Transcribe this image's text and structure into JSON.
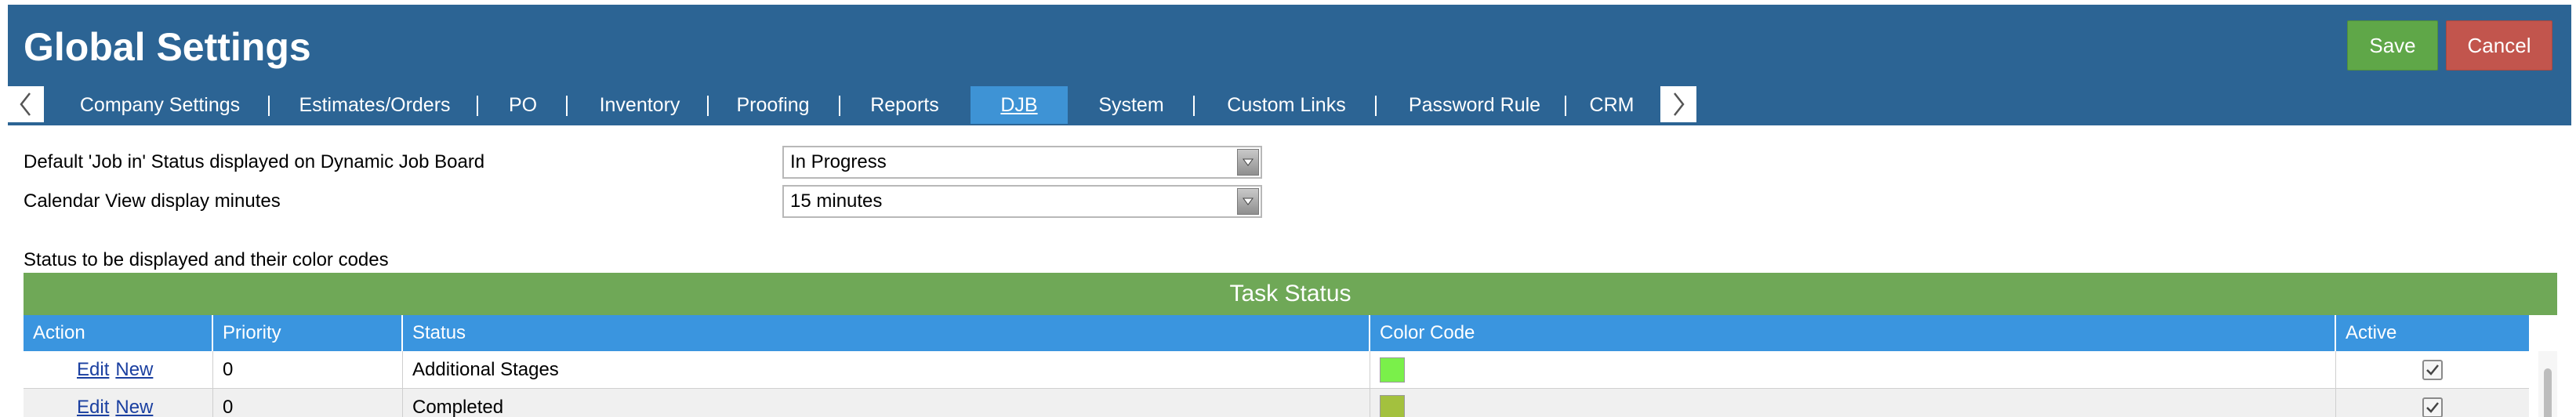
{
  "header": {
    "title": "Global Settings",
    "save_label": "Save",
    "cancel_label": "Cancel"
  },
  "tabs": [
    {
      "label": "Company Settings",
      "active": false
    },
    {
      "label": "Estimates/Orders",
      "active": false
    },
    {
      "label": "PO",
      "active": false
    },
    {
      "label": "Inventory",
      "active": false
    },
    {
      "label": "Proofing",
      "active": false
    },
    {
      "label": "Reports",
      "active": false
    },
    {
      "label": "DJB",
      "active": true
    },
    {
      "label": "System",
      "active": false
    },
    {
      "label": "Custom Links",
      "active": false
    },
    {
      "label": "Password Rule",
      "active": false
    },
    {
      "label": "CRM",
      "active": false
    }
  ],
  "settings": {
    "job_in_status": {
      "label": "Default 'Job in' Status displayed on Dynamic Job Board",
      "value": "In Progress"
    },
    "calendar_minutes": {
      "label": "Calendar View display minutes",
      "value": "15 minutes"
    }
  },
  "status_section_label": "Status to be displayed and their color codes",
  "task_status_table": {
    "title": "Task Status",
    "columns": [
      "Action",
      "Priority",
      "Status",
      "Color Code",
      "Active"
    ],
    "rows": [
      {
        "edit": "Edit",
        "new": "New",
        "priority": "0",
        "status": "Additional Stages",
        "color": "#7af04a",
        "active": true
      },
      {
        "edit": "Edit",
        "new": "New",
        "priority": "0",
        "status": "Completed",
        "color": "#a3c13e",
        "active": true
      }
    ]
  },
  "colors": {
    "header_bg": "#2c6494",
    "active_tab": "#3e93d5",
    "save_button": "#5fa748",
    "cancel_button": "#c2554d",
    "table_title_bg": "#6fa857",
    "table_header_bg": "#3a95df"
  },
  "icons": {
    "prev_tab": "chevron-left-icon",
    "next_tab": "chevron-right-icon",
    "dropdown": "triangle-down-icon",
    "check": "checkmark-icon"
  }
}
